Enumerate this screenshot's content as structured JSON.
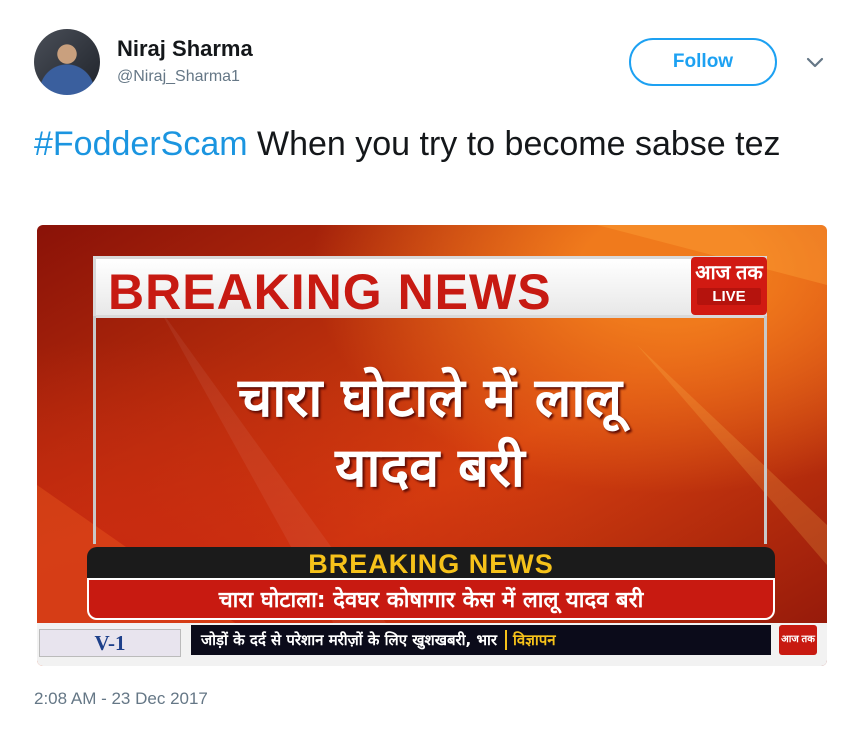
{
  "user": {
    "display_name": "Niraj Sharma",
    "handle": "@Niraj_Sharma1",
    "avatar_icon": "user-avatar"
  },
  "actions": {
    "follow_label": "Follow",
    "more_icon": "chevron-down-icon"
  },
  "tweet": {
    "hashtag": "#FodderScam",
    "text": " When you try to become sabse tez"
  },
  "media": {
    "banner": "BREAKING NEWS",
    "channel_logo": "आज तक",
    "live_badge": "LIVE",
    "headline_line1": "चारा घोटाले में लालू",
    "headline_line2": "यादव बरी",
    "band_title": "BREAKING NEWS",
    "band_subline": "चारा घोटाला: देवघर कोषागार केस में लालू यादव बरी",
    "ad_logo": "V-1",
    "ticker_text": "जोड़ों के दर्द से परेशान मरीज़ों के लिए खुशखबरी, भार",
    "ad_tag": "विज्ञापन",
    "ticker_logo": "आज तक"
  },
  "timestamp": "2:08 AM - 23 Dec 2017",
  "colors": {
    "link": "#1b95e0",
    "follow": "#1da1f2",
    "breaking_red": "#c71a12"
  }
}
